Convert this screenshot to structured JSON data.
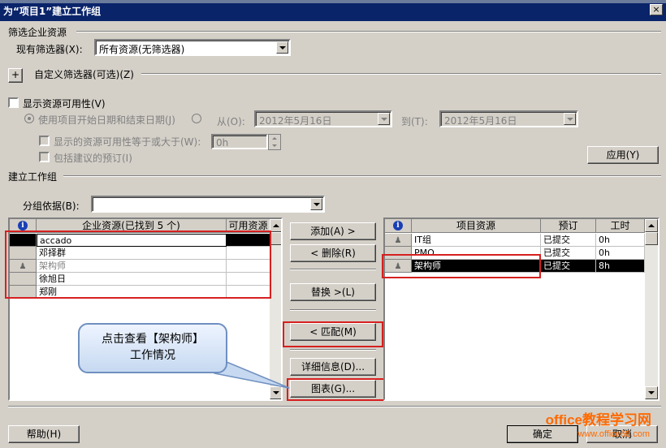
{
  "window": {
    "title": "为“项目1”建立工作组",
    "close_glyph": "×"
  },
  "filter": {
    "section_label": "筛选企业资源",
    "existing_filter_label": "现有筛选器(X):",
    "existing_filter_value": "所有资源(无筛选器)",
    "custom_toggle": "+",
    "custom_filter_label": "自定义筛选器(可选)(Z)"
  },
  "availability": {
    "show_label": "显示资源可用性(V)",
    "use_project_dates_label": "使用项目开始日期和结束日期(J)",
    "from_label": "从(O):",
    "from_value": "2012年5月16日",
    "to_label": "到(T):",
    "to_value": "2012年5月16日",
    "show_available_label": "显示的资源可用性等于或大于(W):",
    "available_value": "0h",
    "include_proposed_label": "包括建议的预订(I)",
    "apply_button": "应用(Y)"
  },
  "team": {
    "section_label": "建立工作组",
    "group_by_label": "分组依据(B):",
    "group_by_value": ""
  },
  "enterprise_grid": {
    "columns": [
      "企业资源(已找到 5 个)",
      "可用资源"
    ],
    "rows": [
      {
        "name": "accado",
        "available": ""
      },
      {
        "name": "邓择群",
        "available": ""
      },
      {
        "name": "架构师",
        "available": ""
      },
      {
        "name": "徐旭日",
        "available": ""
      },
      {
        "name": "郑刚",
        "available": ""
      }
    ]
  },
  "middle_buttons": {
    "add": "添加(A) >",
    "remove": "< 删除(R)",
    "replace": "替换 >(L)",
    "match": "< 匹配(M)",
    "details": "详细信息(D)...",
    "graphs": "图表(G)..."
  },
  "project_grid": {
    "columns": [
      "项目资源",
      "预订",
      "工时"
    ],
    "rows": [
      {
        "name": "IT组",
        "booking": "已提交",
        "work": "0h"
      },
      {
        "name": "PMO",
        "booking": "已提交",
        "work": "0h"
      },
      {
        "name": "架构师",
        "booking": "已提交",
        "work": "8h"
      }
    ]
  },
  "callout": {
    "line1": "点击查看【架构师】",
    "line2": "工作情况"
  },
  "footer": {
    "help_button": "帮助(H)",
    "ok_button": "确定",
    "cancel_button": "取消"
  },
  "watermark": {
    "line1": "office教程学习网",
    "line2": "www.office68.com"
  },
  "colors": {
    "highlight_box": "#d62020",
    "title_bar": "#0a246a",
    "watermark": "#ff6a00"
  }
}
